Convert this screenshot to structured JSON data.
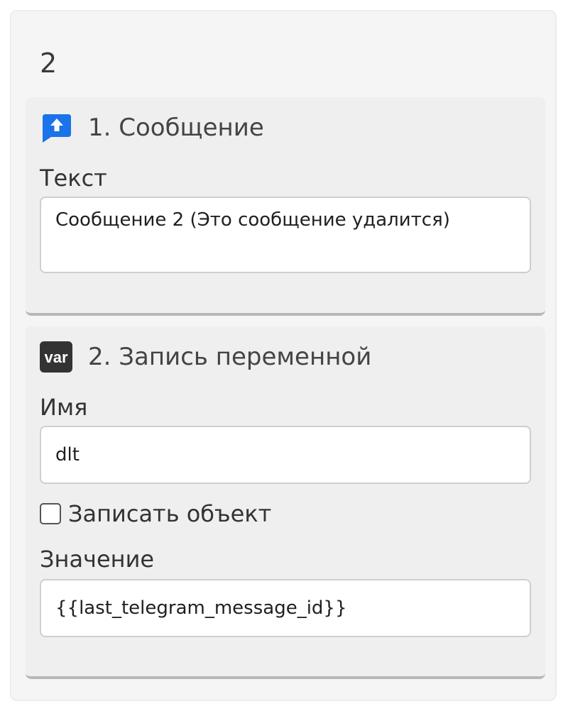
{
  "card": {
    "title": "2"
  },
  "blocks": [
    {
      "icon": "message-upload-icon",
      "icon_color": "#1a73e8",
      "title": "1. Сообщение",
      "fields": {
        "text_label": "Текст",
        "text_value": "Сообщение 2 (Это сообщение удалится)"
      }
    },
    {
      "icon": "variable-icon",
      "icon_label": "var",
      "icon_color": "#333333",
      "title": "2. Запись переменной",
      "fields": {
        "name_label": "Имя",
        "name_value": "dlt",
        "checkbox_label": "Записать объект",
        "checkbox_checked": false,
        "value_label": "Значение",
        "value_value": "{{last_telegram_message_id}}"
      }
    }
  ]
}
